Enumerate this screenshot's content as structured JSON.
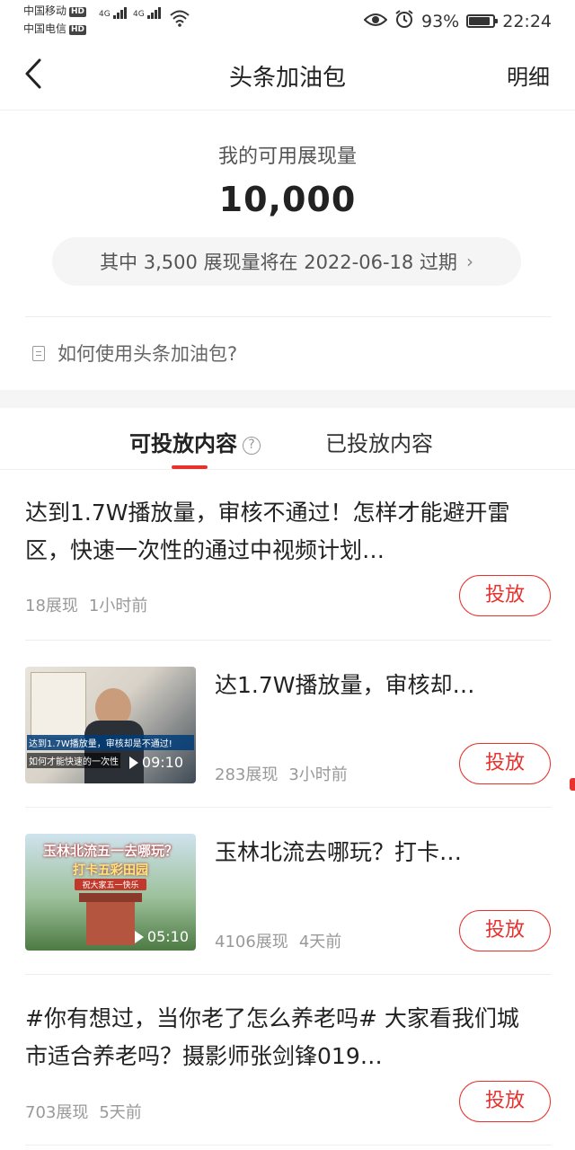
{
  "status_bar": {
    "carrier1": "中国移动",
    "carrier2": "中国电信",
    "hd_badge": "HD",
    "net1": "4G",
    "net2": "4G",
    "battery": "93%",
    "battery_level": 0.93,
    "time": "22:24"
  },
  "nav": {
    "back_icon": "chevron-left-icon",
    "title": "头条加油包",
    "detail_link": "明细"
  },
  "summary": {
    "label": "我的可用展现量",
    "value": "10,000",
    "expiry_notice": "其中 3,500 展现量将在 2022-06-18 过期",
    "chevron": "›"
  },
  "help_link": "如何使用头条加油包?",
  "tabs": [
    {
      "label": "可投放内容",
      "active": true,
      "help_icon": "?"
    },
    {
      "label": "已投放内容",
      "active": false
    }
  ],
  "items": [
    {
      "title": "达到1.7W播放量，审核不通过！怎样才能避开雷区，快速一次性的通过中视频计划…",
      "impressions": "18展现",
      "time": "1小时前",
      "action": "投放"
    },
    {
      "title": "达1.7W播放量，审核却…",
      "impressions": "283展现",
      "time": "3小时前",
      "action": "投放",
      "thumb_caption1": "达到1.7W播放量，审核却是不通过!",
      "thumb_caption2": "如何才能快速的一次性",
      "duration": "09:10"
    },
    {
      "title": "玉林北流去哪玩？打卡…",
      "impressions": "4106展现",
      "time": "4天前",
      "action": "投放",
      "thumb_caption1": "玉林北流五一去哪玩？",
      "thumb_caption2": "打卡五彩田园",
      "thumb_caption3": "祝大家五一快乐",
      "duration": "05:10"
    },
    {
      "title": "#你有想过，当你老了怎么养老吗# 大家看我们城市适合养老吗？摄影师张剑锋019…",
      "impressions": "703展现",
      "time": "5天前",
      "action": "投放"
    }
  ],
  "colors": {
    "accent": "#e8312c",
    "text": "#222222",
    "muted": "#999999"
  }
}
